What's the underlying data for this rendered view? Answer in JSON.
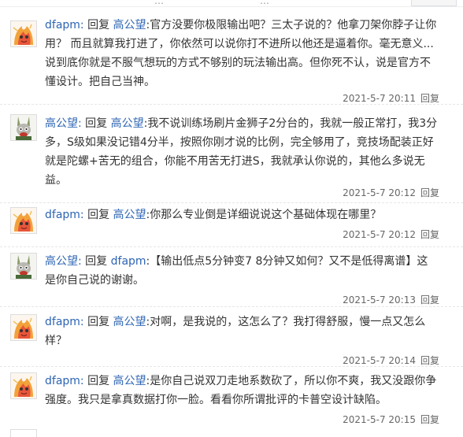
{
  "colors": {
    "link": "#2d64b3",
    "text": "#333333",
    "meta": "#666666"
  },
  "top_bar": {
    "fragments": [
      "…",
      "…"
    ]
  },
  "reply_word": "回复",
  "reply_action": "回复",
  "replies": [
    {
      "author": "dfapm:",
      "avatar_icon": "flame-cartoon-avatar",
      "target": "高公望",
      "text": ":官方没要你极限输出吧？三太子说的？他拿刀架你脖子让你用？ 而且就算我打进了，你依然可以说你打不进所以他还是逼着你。毫无意义...说到底你就是不服气想玩的方式不够别的玩法输出高。但你死不认，说是官方不懂设计。把自己当神。",
      "time": "2021-5-7 20:11"
    },
    {
      "author": "高公望:",
      "avatar_icon": "rabbit-avatar",
      "target": "高公望",
      "text": ":我不说训练场刷片金狮子2分台的，我就一般正常打，我3分多，S级如果没记错4分半，按照你刚才说的比例，完全够用了，竞技场配装正好就是陀螺+苦无的组合，你能不用苦无打进S，我就承认你说的，其他么多说无益。",
      "time": "2021-5-7 20:12"
    },
    {
      "author": "dfapm:",
      "avatar_icon": "flame-cartoon-avatar",
      "target": "高公望",
      "text": ":你那么专业倒是详细说说这个基础体现在哪里？",
      "time": "2021-5-7 20:12"
    },
    {
      "author": "高公望:",
      "avatar_icon": "rabbit-avatar",
      "target": "dfapm",
      "text": ":【输出低点5分钟变7 8分钟又如何？又不是低得离谱】这是你自己说的谢谢。",
      "time": "2021-5-7 20:13"
    },
    {
      "author": "dfapm:",
      "avatar_icon": "flame-cartoon-avatar",
      "target": "高公望",
      "text": ":对啊，是我说的，这怎么了？我打得舒服，慢一点又怎么样？",
      "time": "2021-5-7 20:14"
    },
    {
      "author": "dfapm:",
      "avatar_icon": "flame-cartoon-avatar",
      "target": "高公望",
      "text": ":是你自己说双刀走地系数砍了，所以你不爽，我又没跟你争强度。我只是拿真数据打你一脸。看看你所谓批评的卡普空设计缺陷。",
      "time": "2021-5-7 20:15"
    }
  ]
}
